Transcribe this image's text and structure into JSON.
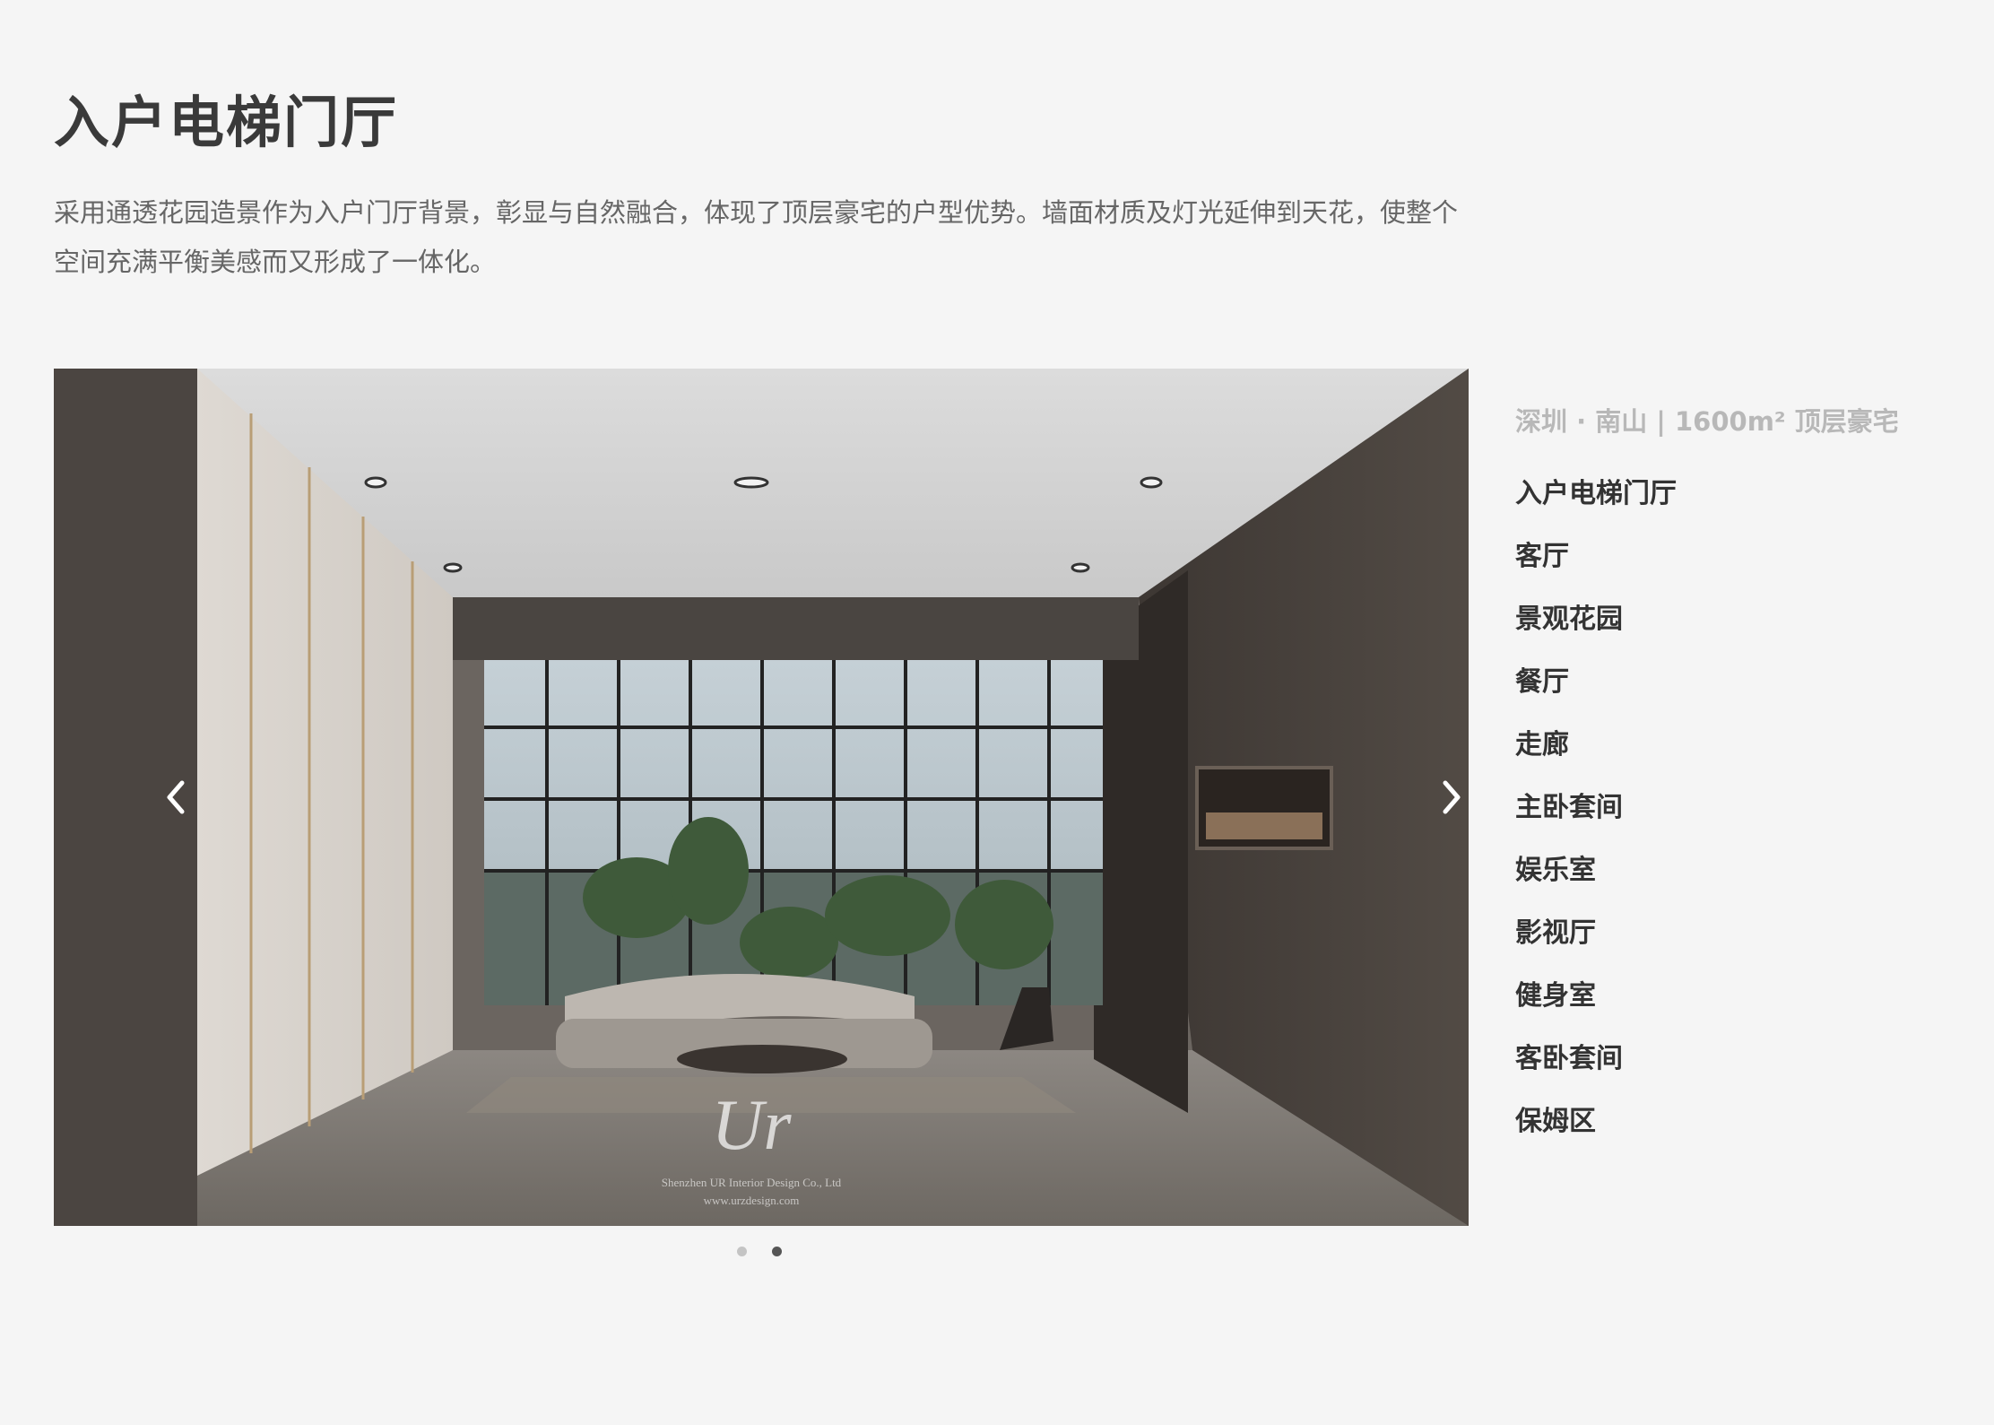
{
  "page": {
    "title": "入户电梯门厅",
    "description": "采用通透花园造景作为入户门厅背景，彰显与自然融合，体现了顶层豪宅的户型优势。墙面材质及灯光延伸到天花，使整个空间充满平衡美感而又形成了一体化。"
  },
  "slider": {
    "image_semantic": "elevator-lobby-rendering",
    "watermark_logo": "Ur",
    "watermark_line1": "Shenzhen UR Interior Design Co., Ltd",
    "watermark_line2": "www.urzdesign.com",
    "prev_icon": "chevron-left-icon",
    "next_icon": "chevron-right-icon",
    "dot_count": 2,
    "active_dot_index": 1
  },
  "sidebar": {
    "project_label": "深圳 · 南山 | 1600m² 顶层豪宅",
    "items": [
      {
        "label": "入户电梯门厅"
      },
      {
        "label": "客厅"
      },
      {
        "label": "景观花园"
      },
      {
        "label": "餐厅"
      },
      {
        "label": "走廊"
      },
      {
        "label": "主卧套间"
      },
      {
        "label": "娱乐室"
      },
      {
        "label": "影视厅"
      },
      {
        "label": "健身室"
      },
      {
        "label": "客卧套间"
      },
      {
        "label": "保姆区"
      }
    ]
  },
  "colors": {
    "background": "#f5f5f5",
    "title": "#3a3a3a",
    "description": "#666666",
    "project_label": "#b8b8b8",
    "nav_item": "#333333",
    "dot_inactive": "#c4c4c4",
    "dot_active": "#555555"
  }
}
